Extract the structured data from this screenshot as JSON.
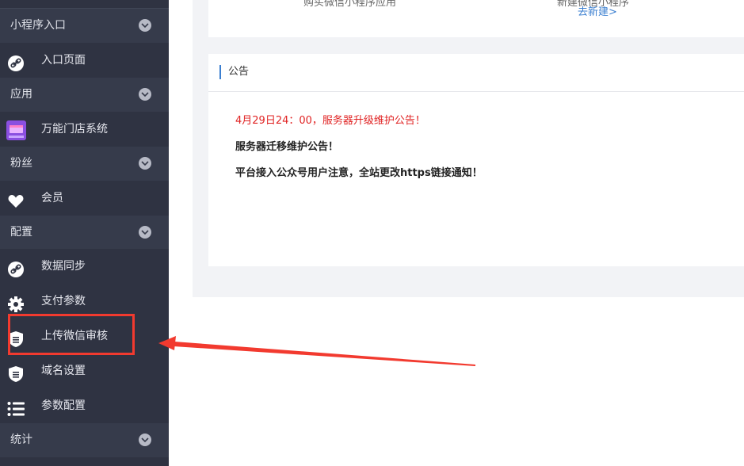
{
  "sidebar": {
    "sections": [
      {
        "label": "小程序入口"
      },
      {
        "label": "应用"
      },
      {
        "label": "粉丝"
      },
      {
        "label": "配置"
      },
      {
        "label": "统计"
      }
    ],
    "items": [
      {
        "label": "入口页面",
        "icon": "link-icon"
      },
      {
        "label": "万能门店系统",
        "icon": "store-app-icon"
      },
      {
        "label": "会员",
        "icon": "heart-icon"
      },
      {
        "label": "数据同步",
        "icon": "link-icon"
      },
      {
        "label": "支付参数",
        "icon": "gear-icon"
      },
      {
        "label": "上传微信审核",
        "icon": "shield-icon"
      },
      {
        "label": "域名设置",
        "icon": "shield-icon"
      },
      {
        "label": "参数配置",
        "icon": "list-icon"
      }
    ]
  },
  "top_card": {
    "cut_text_1": "购买微信小程序应用",
    "cut_text_2": "新建微信小程序",
    "new_link": "去新建>"
  },
  "notice": {
    "title": "公告",
    "items": [
      "4月29日24：00，服务器升级维护公告！",
      "服务器迁移维护公告！",
      "平台接入公众号用户注意，全站更改https链接通知！"
    ]
  },
  "colors": {
    "sidebar_bg": "#2f3342",
    "section_bg": "#363b4b",
    "accent_blue": "#3b7fd0",
    "alert_red": "#e02222",
    "annotation_red": "#f23a2f"
  }
}
